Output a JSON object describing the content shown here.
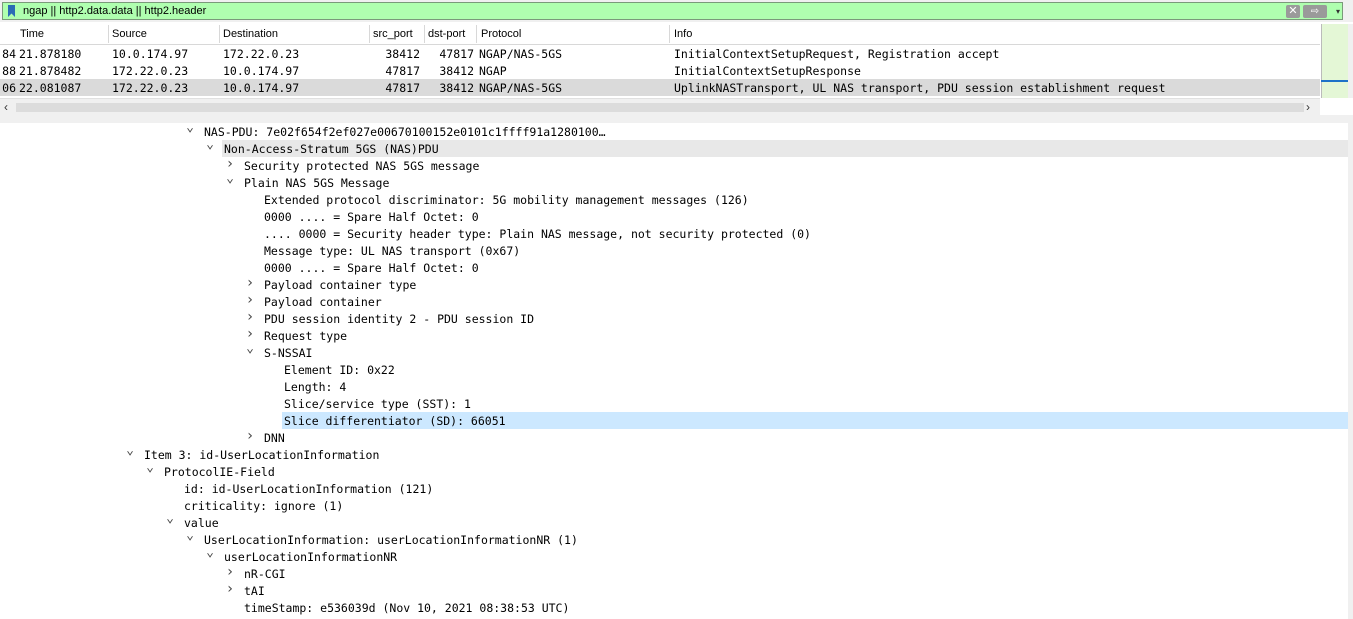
{
  "filter": {
    "text": "ngap || http2.data.data || http2.header",
    "clear_label": "✕",
    "apply_label": "⇨",
    "dropdown_label": "▾"
  },
  "packet_list": {
    "columns": [
      "Time",
      "Source",
      "Destination",
      "src_port",
      "dst-port",
      "Protocol",
      "Info"
    ],
    "rows": [
      {
        "no": "84",
        "time": "21.878180",
        "source": "10.0.174.97",
        "destination": "172.22.0.23",
        "src_port": "38412",
        "dst_port": "47817",
        "protocol": "NGAP/NAS-5GS",
        "info": "InitialContextSetupRequest, Registration accept"
      },
      {
        "no": "88",
        "time": "21.878482",
        "source": "172.22.0.23",
        "destination": "10.0.174.97",
        "src_port": "47817",
        "dst_port": "38412",
        "protocol": "NGAP",
        "info": "InitialContextSetupResponse"
      },
      {
        "no": "06",
        "time": "22.081087",
        "source": "172.22.0.23",
        "destination": "10.0.174.97",
        "src_port": "47817",
        "dst_port": "38412",
        "protocol": "NGAP/NAS-5GS",
        "info": "UplinkNASTransport, UL NAS transport, PDU session establishment request"
      }
    ]
  },
  "scroll": {
    "left_arrow": "‹",
    "right_arrow": "›"
  },
  "tree": [
    {
      "level": 0,
      "arrow": "down",
      "text": "NAS-PDU: 7e02f654f2ef027e00670100152e0101c1ffff91a1280100…"
    },
    {
      "level": 1,
      "arrow": "down",
      "text": "Non-Access-Stratum 5GS (NAS)PDU",
      "highlight": "gray"
    },
    {
      "level": 2,
      "arrow": "right",
      "text": "Security protected NAS 5GS message"
    },
    {
      "level": 2,
      "arrow": "down",
      "text": "Plain NAS 5GS Message"
    },
    {
      "level": 3,
      "arrow": "none",
      "text": "Extended protocol discriminator: 5G mobility management messages (126)"
    },
    {
      "level": 3,
      "arrow": "none",
      "text": "0000 .... = Spare Half Octet: 0"
    },
    {
      "level": 3,
      "arrow": "none",
      "text": ".... 0000 = Security header type: Plain NAS message, not security protected (0)"
    },
    {
      "level": 3,
      "arrow": "none",
      "text": "Message type: UL NAS transport (0x67)"
    },
    {
      "level": 3,
      "arrow": "none",
      "text": "0000 .... = Spare Half Octet: 0"
    },
    {
      "level": 3,
      "arrow": "right",
      "text": "Payload container type"
    },
    {
      "level": 3,
      "arrow": "right",
      "text": "Payload container"
    },
    {
      "level": 3,
      "arrow": "right",
      "text": "PDU session identity 2 - PDU session ID"
    },
    {
      "level": 3,
      "arrow": "right",
      "text": "Request type"
    },
    {
      "level": 3,
      "arrow": "down",
      "text": "S-NSSAI"
    },
    {
      "level": 4,
      "arrow": "none",
      "text": "Element ID: 0x22"
    },
    {
      "level": 4,
      "arrow": "none",
      "text": "Length: 4"
    },
    {
      "level": 4,
      "arrow": "none",
      "text": "Slice/service type (SST): 1"
    },
    {
      "level": 4,
      "arrow": "none",
      "text": "Slice differentiator (SD): 66051",
      "highlight": "blue"
    },
    {
      "level": 3,
      "arrow": "right",
      "text": "DNN"
    },
    {
      "level": -3,
      "arrow": "down",
      "text": "Item 3: id-UserLocationInformation"
    },
    {
      "level": -2,
      "arrow": "down",
      "text": "ProtocolIE-Field"
    },
    {
      "level": -1,
      "arrow": "none",
      "text": "id: id-UserLocationInformation (121)"
    },
    {
      "level": -1,
      "arrow": "none",
      "text": "criticality: ignore (1)"
    },
    {
      "level": -1,
      "arrow": "down",
      "text": "value"
    },
    {
      "level": 0,
      "arrow": "down",
      "text": "UserLocationInformation: userLocationInformationNR (1)"
    },
    {
      "level": 1,
      "arrow": "down",
      "text": "userLocationInformationNR"
    },
    {
      "level": 2,
      "arrow": "right",
      "text": "nR-CGI"
    },
    {
      "level": 2,
      "arrow": "right",
      "text": "tAI"
    },
    {
      "level": 2,
      "arrow": "none",
      "text": "timeStamp: e536039d (Nov 10, 2021 08:38:53 UTC)"
    }
  ]
}
